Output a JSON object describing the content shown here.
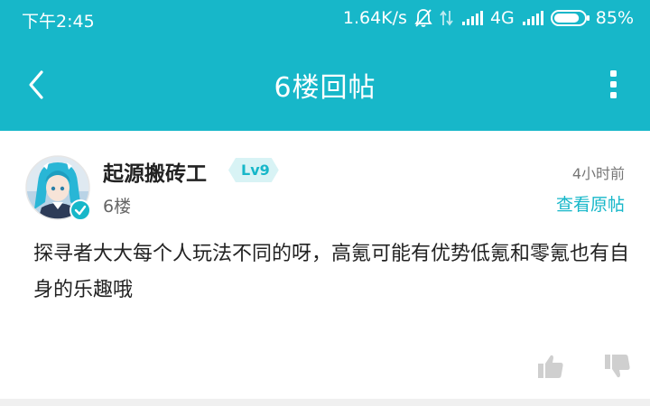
{
  "status_bar": {
    "time": "下午2:45",
    "network_speed": "1.64K/s",
    "network_type": "4G",
    "battery_percent": "85%",
    "battery_level": 0.85
  },
  "header": {
    "title": "6楼回帖",
    "back_icon": "chevron-left-icon",
    "more_icon": "more-vertical-icon"
  },
  "post": {
    "username": "起源搬砖工",
    "level": "Lv9",
    "floor": "6楼",
    "time_ago": "4小时前",
    "view_original_label": "查看原帖",
    "content": "探寻者大大每个人玩法不同的呀，高氪可能有优势低氪和零氪也有自身的乐趣哦",
    "like_icon": "thumbs-up-icon",
    "dislike_icon": "thumbs-down-icon"
  },
  "colors": {
    "accent": "#17b7c9",
    "text_primary": "#222222",
    "text_secondary": "#666666",
    "level_badge_bg": "#d8f3f5"
  }
}
